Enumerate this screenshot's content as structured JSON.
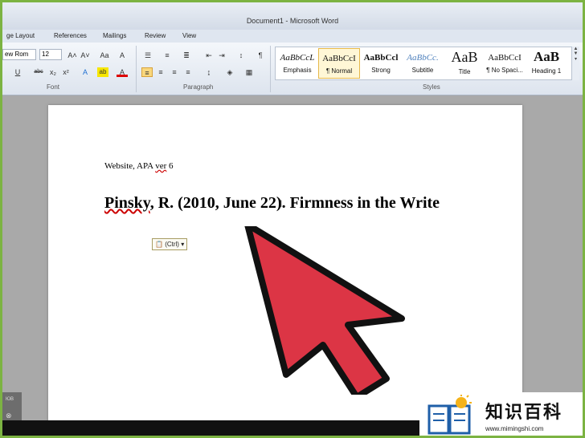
{
  "window": {
    "title": "Document1  -  Microsoft Word"
  },
  "menu": [
    "ge Layout",
    "References",
    "Mailings",
    "Review",
    "View"
  ],
  "ribbon": {
    "font_name": "ew Rom",
    "font_size": "12",
    "grow_font": "A˄",
    "shrink_font": "A˅",
    "change_case": "Aa",
    "clear_format": "A",
    "underline": "U",
    "strikethrough": "abc",
    "subscript": "x₂",
    "superscript": "x²",
    "text_effects": "A",
    "highlight": "ab",
    "font_color": "A",
    "font_group": "Font",
    "paragraph_group": "Paragraph",
    "styles_group": "Styles"
  },
  "styles": [
    {
      "sample": "AaBbCcL",
      "name": "Emphasis"
    },
    {
      "sample": "AaBbCcI",
      "name": "¶ Normal"
    },
    {
      "sample": "AaBbCcl",
      "name": "Strong"
    },
    {
      "sample": "AaBbCc.",
      "name": "Subtitle"
    },
    {
      "sample": "AaB",
      "name": "Title"
    },
    {
      "sample": "AaBbCcI",
      "name": "¶ No Spaci..."
    },
    {
      "sample": "AaB",
      "name": "Heading 1"
    }
  ],
  "document": {
    "line1": {
      "a": "Website, APA ",
      "b": "ver",
      "c": " 6"
    },
    "citation": {
      "author": "Pinsky",
      "rest": ", R. (2010, June 22). Firmness in the Write"
    },
    "paste_options": "(Ctrl)"
  },
  "leftpanel": {
    "a": "ЮB",
    "b": "⊗"
  },
  "watermark": {
    "title": "知识百科",
    "url": "www.mimingshi.com"
  },
  "colors": {
    "arrow": "#dc3545",
    "frame": "#7cb342"
  }
}
